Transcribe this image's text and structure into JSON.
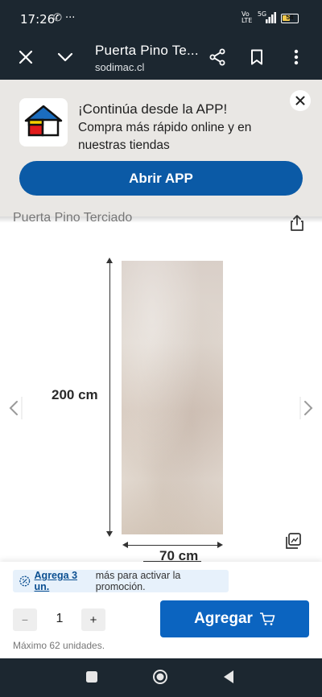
{
  "status_bar": {
    "time": "17:26",
    "notification_icons": [
      "whatsapp-icon",
      "more-dots-icon"
    ],
    "network_left": "Vo\nLTE",
    "network_right": "5G",
    "battery": "54",
    "battery_level": 0.54,
    "battery_color": "#f2c94c"
  },
  "top_bar": {
    "page_title": "Puerta Pino Te...",
    "domain": "sodimac.cl",
    "background": "#1c2730"
  },
  "banner": {
    "heading": "¡Continúa desde la APP!",
    "subtext": "Compra más rápido online y en nuestras tiendas",
    "button_label": "Abrir APP",
    "button_color": "#0b5aa6"
  },
  "product": {
    "title": "Puerta Pino Terciado",
    "height_label": "200 cm",
    "width_label": "70 cm"
  },
  "purchase": {
    "promo_link": "Agrega 3 un.",
    "promo_text": "más para activar la promoción.",
    "minus_label": "−",
    "quantity": "1",
    "plus_label": "+",
    "max_text": "Máximo 62 unidades.",
    "add_label": "Agregar",
    "add_color": "#0b64c0"
  }
}
